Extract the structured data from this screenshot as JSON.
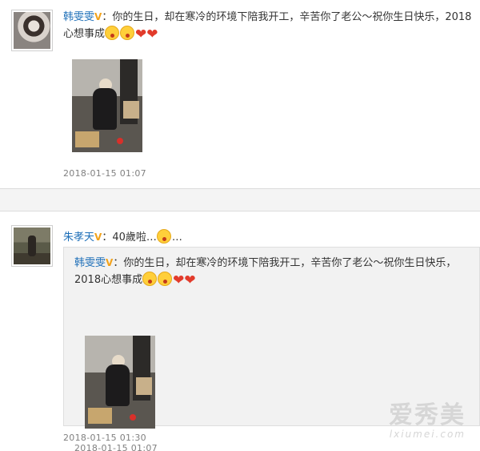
{
  "posts": [
    {
      "author": "韩雯雯",
      "verified_badge": "V",
      "text_main": "：你的生日，却在寒冷的环境下陪我开工，辛苦你了老公～祝你生日快乐，2018心想事成",
      "emojis": [
        "scream-emoji",
        "scream-emoji"
      ],
      "hearts": [
        "❤",
        "❤"
      ],
      "timestamp": "2018-01-15 01:07"
    },
    {
      "author": "朱孝天",
      "verified_badge": "V",
      "text_main": "：40歲啦…",
      "emoji": "crying-emoji",
      "text_suffix": "…",
      "repost": {
        "author": "韩雯雯",
        "verified_badge": "V",
        "text_main": "：你的生日，却在寒冷的环境下陪我开工，辛苦你了老公～祝你生日快乐，2018心想事成",
        "emojis": [
          "scream-emoji",
          "scream-emoji"
        ],
        "hearts": [
          "❤",
          "❤"
        ],
        "timestamp": "2018-01-15 01:07"
      },
      "timestamp": "2018-01-15 01:30"
    }
  ],
  "watermark": {
    "chinese": "爱秀美",
    "url": "lxiumei.com"
  },
  "colors": {
    "author_link": "#1e6fb8",
    "verified_badge": "#f2a21b",
    "heart": "#e23b2b",
    "timestamp": "#808080",
    "repost_bg": "#f2f2f2"
  }
}
